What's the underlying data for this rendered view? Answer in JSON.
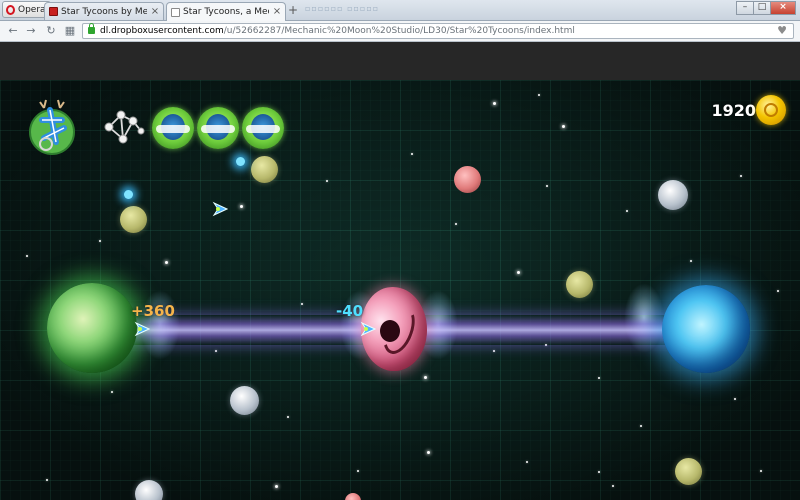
{
  "browser": {
    "menu_label": "Opera",
    "tabs": [
      {
        "title": "Star Tycoons by Mechanic",
        "active": false
      },
      {
        "title": "Star Tycoons, a Mechanic",
        "active": true
      }
    ],
    "tab_close_glyph": "×",
    "new_tab_glyph": "+",
    "ghost_tabs_text": "▫▫▫▫▫▫   ▫▫▫▫▫",
    "window_controls": {
      "minimize": "–",
      "maximize": "□",
      "close": "×"
    },
    "nav": {
      "back": "←",
      "forward": "→",
      "reload": "↻",
      "speed_dial": "▦"
    },
    "address": {
      "domain": "dl.dropboxusercontent.com",
      "path": "/u/52662287/Mechanic%20Moon%20Studio/LD30/Star%20Tycoons/index.html"
    },
    "bookmark_glyph": "♥"
  },
  "game": {
    "hud": {
      "score": "1920",
      "fleet_count": 3,
      "icons": [
        "game-logo-icon",
        "network-icon",
        "fleet-ship-icon",
        "coin-icon"
      ]
    },
    "floating_labels": {
      "gain": "+360",
      "loss": "-40"
    },
    "colors": {
      "home_planet": "#3fa543",
      "target_planet": "#1c84d2",
      "enemy_planet": "#d45a80",
      "beam": "#a98cf0",
      "gain_text": "#f5b44a",
      "loss_text": "#4fe0ff",
      "coin": "#f4c400"
    }
  }
}
